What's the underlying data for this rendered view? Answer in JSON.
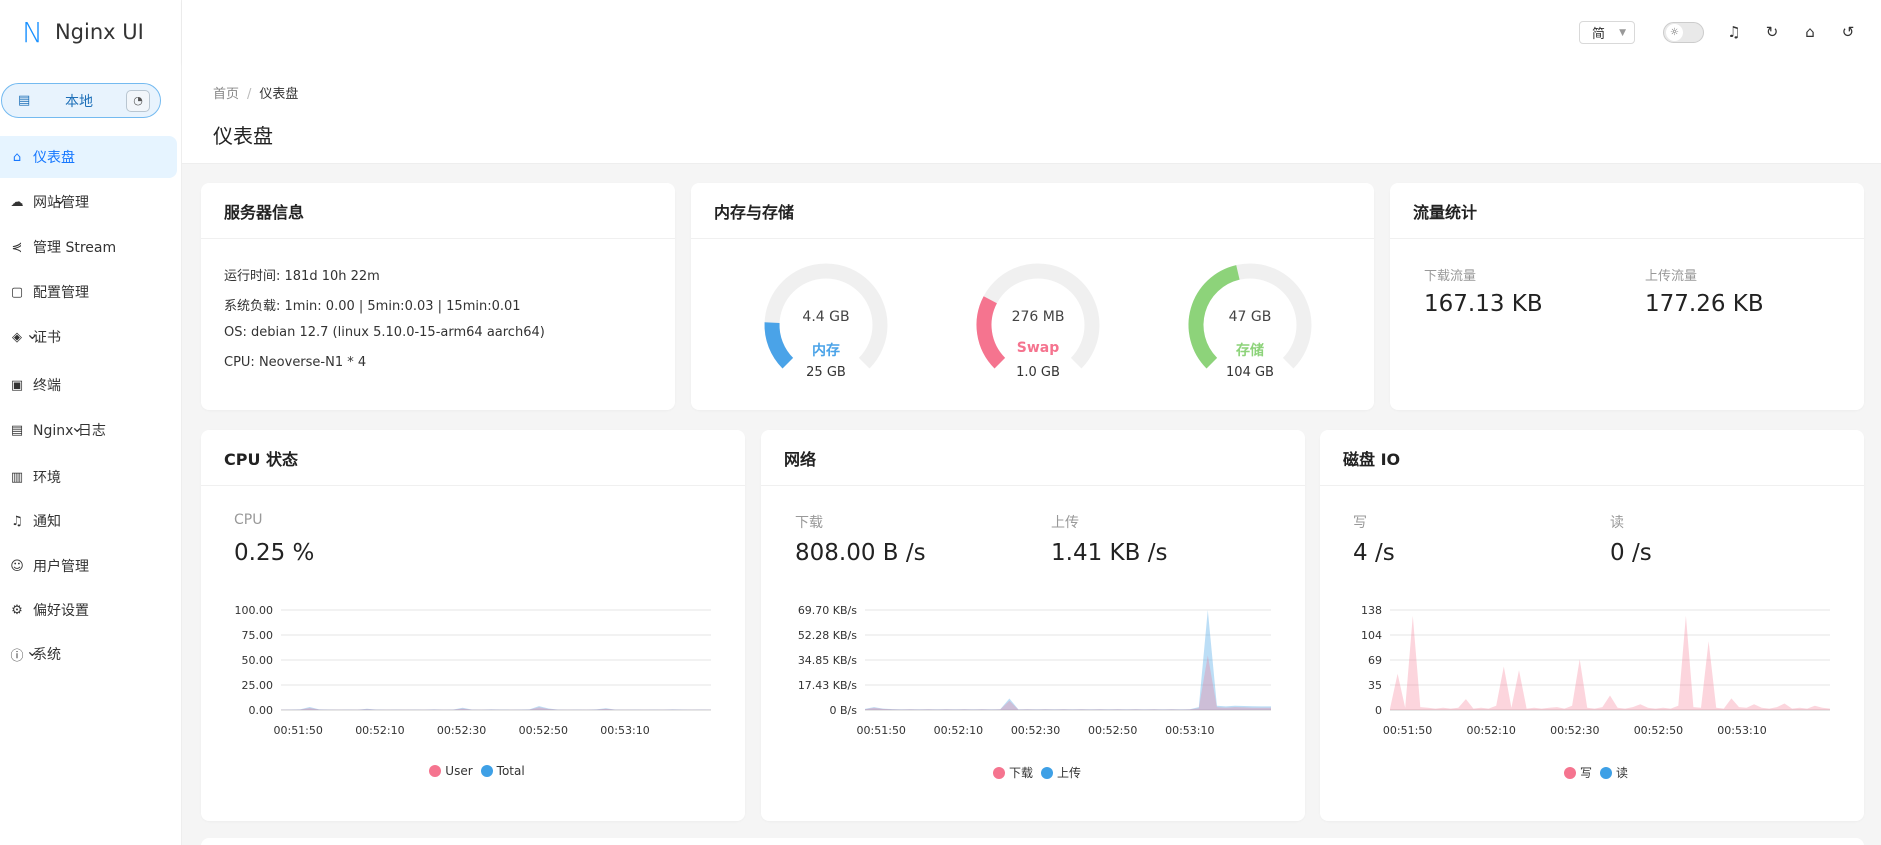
{
  "app": {
    "logo_letter": "N",
    "title": "Nginx UI"
  },
  "env": {
    "label": "本地",
    "icon": "server-icon",
    "action_icon": "dashboard-icon"
  },
  "sidebar": {
    "items": [
      {
        "label": "仪表盘",
        "icon": "home-icon",
        "active": true,
        "expandable": false
      },
      {
        "label": "网站管理",
        "icon": "cloud-icon",
        "expandable": true
      },
      {
        "label": "管理 Stream",
        "icon": "share-icon",
        "expandable": false
      },
      {
        "label": "配置管理",
        "icon": "file-icon",
        "expandable": false
      },
      {
        "label": "证书",
        "icon": "shield-check-icon",
        "expandable": true
      },
      {
        "label": "终端",
        "icon": "terminal-icon",
        "expandable": false
      },
      {
        "label": "Nginx 日志",
        "icon": "file-text-icon",
        "expandable": true
      },
      {
        "label": "环境",
        "icon": "database-icon",
        "expandable": false
      },
      {
        "label": "通知",
        "icon": "bell-icon",
        "expandable": false
      },
      {
        "label": "用户管理",
        "icon": "user-icon",
        "expandable": false
      },
      {
        "label": "偏好设置",
        "icon": "gear-icon",
        "expandable": false
      },
      {
        "label": "系统",
        "icon": "info-icon",
        "expandable": true
      }
    ]
  },
  "header": {
    "lang": "简",
    "icons": [
      "sun-icon",
      "bell-icon",
      "reload-icon",
      "home-icon",
      "logout-icon"
    ]
  },
  "page": {
    "breadcrumb": [
      "首页",
      "仪表盘"
    ],
    "title": "仪表盘"
  },
  "server_info": {
    "title": "服务器信息",
    "uptime": "运行时间: 181d 10h 22m",
    "load": "系统负载: 1min: 0.00 | 5min:0.03 | 15min:0.01",
    "os": "OS: debian 12.7 (linux 5.10.0-15-arm64 aarch64)",
    "cpu": "CPU: Neoverse-N1 * 4"
  },
  "memory_storage": {
    "title": "内存与存储",
    "gauges": [
      {
        "used": "4.4 GB",
        "name": "内存",
        "total": "25 GB",
        "fraction": 0.176,
        "color": "#4aa3e8"
      },
      {
        "used": "276 MB",
        "name": "Swap",
        "total": "1.0 GB",
        "fraction": 0.27,
        "color": "#f5748f"
      },
      {
        "used": "47 GB",
        "name": "存储",
        "total": "104 GB",
        "fraction": 0.452,
        "color": "#8dd37a"
      }
    ]
  },
  "traffic": {
    "title": "流量统计",
    "download_label": "下载流量",
    "download_value": "167.13 KB",
    "upload_label": "上传流量",
    "upload_value": "177.26 KB"
  },
  "cpu_card": {
    "title": "CPU 状态",
    "label": "CPU",
    "value": "0.25 %"
  },
  "network_card": {
    "title": "网络",
    "down_label": "下载",
    "down_value": "808.00 B /s",
    "up_label": "上传",
    "up_value": "1.41 KB /s"
  },
  "disk_card": {
    "title": "磁盘 IO",
    "write_label": "写",
    "write_value": "4 /s",
    "read_label": "读",
    "read_value": "0 /s"
  },
  "chart_data": [
    {
      "type": "area",
      "title": "CPU",
      "y_ticks": [
        "100.00",
        "75.00",
        "50.00",
        "25.00",
        "0.00"
      ],
      "ylim": [
        0,
        100
      ],
      "x_ticks": [
        "00:51:50",
        "00:52:10",
        "00:52:30",
        "00:52:50",
        "00:53:10"
      ],
      "series": [
        {
          "name": "User",
          "color": "#f5748f",
          "values": [
            0.2,
            0.3,
            0.4,
            2.1,
            0.4,
            0.3,
            0.2,
            0.3,
            0.2,
            0.8,
            0.3,
            0.2,
            0.3,
            0.2,
            0.3,
            0.2,
            0.4,
            0.2,
            0.3,
            1.5,
            0.3,
            0.2,
            0.4,
            0.3,
            0.2,
            0.3,
            0.4,
            2.8,
            1.0,
            0.3,
            0.2,
            0.3,
            0.2,
            0.4,
            1.3,
            0.3,
            0.2,
            0.3,
            0.2,
            0.3,
            0.2,
            0.4,
            0.3,
            0.2,
            0.3,
            0.2
          ]
        },
        {
          "name": "Total",
          "color": "#3ea0e6",
          "values": [
            0.3,
            0.4,
            0.6,
            3.0,
            0.6,
            0.4,
            0.3,
            0.4,
            0.3,
            1.2,
            0.4,
            0.3,
            0.4,
            0.3,
            0.4,
            0.3,
            0.6,
            0.3,
            0.4,
            2.2,
            0.4,
            0.3,
            0.6,
            0.4,
            0.3,
            0.4,
            0.6,
            3.9,
            1.5,
            0.4,
            0.3,
            0.4,
            0.3,
            0.6,
            1.8,
            0.4,
            0.3,
            0.4,
            0.3,
            0.4,
            0.3,
            0.6,
            0.4,
            0.3,
            0.4,
            0.3
          ]
        }
      ]
    },
    {
      "type": "area",
      "title": "网络",
      "y_ticks": [
        "69.70 KB/s",
        "52.28 KB/s",
        "34.85 KB/s",
        "17.43 KB/s",
        "0 B/s"
      ],
      "ylim": [
        0,
        69.7
      ],
      "x_ticks": [
        "00:51:50",
        "00:52:10",
        "00:52:30",
        "00:52:50",
        "00:53:10"
      ],
      "series": [
        {
          "name": "下载",
          "color": "#f5748f",
          "values": [
            0.5,
            1.5,
            0.8,
            0.4,
            0.3,
            0.4,
            0.3,
            0.4,
            0.3,
            0.4,
            0.3,
            0.4,
            0.3,
            0.4,
            0.3,
            0.4,
            6.5,
            0.3,
            0.4,
            0.3,
            0.4,
            0.3,
            0.4,
            0.3,
            0.4,
            0.3,
            0.4,
            0.3,
            0.4,
            0.3,
            0.4,
            0.3,
            0.4,
            0.3,
            0.4,
            0.3,
            0.4,
            1.2,
            38.0,
            2.0,
            1.5,
            2.0,
            1.8,
            1.6,
            1.5,
            1.5
          ]
        },
        {
          "name": "上传",
          "color": "#3ea0e6",
          "values": [
            0.8,
            2.0,
            1.0,
            0.6,
            0.4,
            0.5,
            0.4,
            0.5,
            0.4,
            0.5,
            0.4,
            0.5,
            0.4,
            0.5,
            0.4,
            0.5,
            8.0,
            0.4,
            0.5,
            0.4,
            0.5,
            0.4,
            0.5,
            0.4,
            0.5,
            0.4,
            0.5,
            0.4,
            0.5,
            0.4,
            0.5,
            0.4,
            0.5,
            0.4,
            0.5,
            0.4,
            0.5,
            2.0,
            69.7,
            3.0,
            2.5,
            3.0,
            2.8,
            2.6,
            2.5,
            2.5
          ]
        }
      ]
    },
    {
      "type": "area",
      "title": "磁盘 IO",
      "y_ticks": [
        "138",
        "104",
        "69",
        "35",
        "0"
      ],
      "ylim": [
        0,
        138
      ],
      "x_ticks": [
        "00:51:50",
        "00:52:10",
        "00:52:30",
        "00:52:50",
        "00:53:10"
      ],
      "series": [
        {
          "name": "写",
          "color": "#f5748f",
          "values": [
            2,
            50,
            3,
            130,
            4,
            3,
            2,
            3,
            2,
            3,
            15,
            2,
            3,
            2,
            6,
            60,
            3,
            55,
            2,
            3,
            2,
            3,
            4,
            2,
            6,
            70,
            3,
            2,
            4,
            20,
            3,
            2,
            4,
            8,
            3,
            2,
            3,
            2,
            6,
            130,
            4,
            3,
            95,
            3,
            2,
            16,
            4,
            3,
            8,
            3,
            2,
            4,
            9,
            2,
            3,
            2,
            6,
            3,
            2
          ]
        },
        {
          "name": "读",
          "color": "#3ea0e6",
          "values": [
            0,
            0,
            0,
            0,
            0,
            0,
            0,
            0,
            0,
            0,
            0,
            0,
            0,
            0,
            0,
            0,
            0,
            0,
            0,
            0,
            0,
            0,
            0,
            0,
            0,
            0,
            0,
            0,
            0,
            0,
            0,
            0,
            0,
            0,
            0,
            0,
            0,
            0,
            0,
            0,
            0,
            0,
            0,
            0,
            0,
            0,
            0,
            0,
            0,
            0,
            0,
            0,
            0,
            0,
            0,
            0,
            0,
            0,
            0
          ]
        }
      ]
    }
  ]
}
